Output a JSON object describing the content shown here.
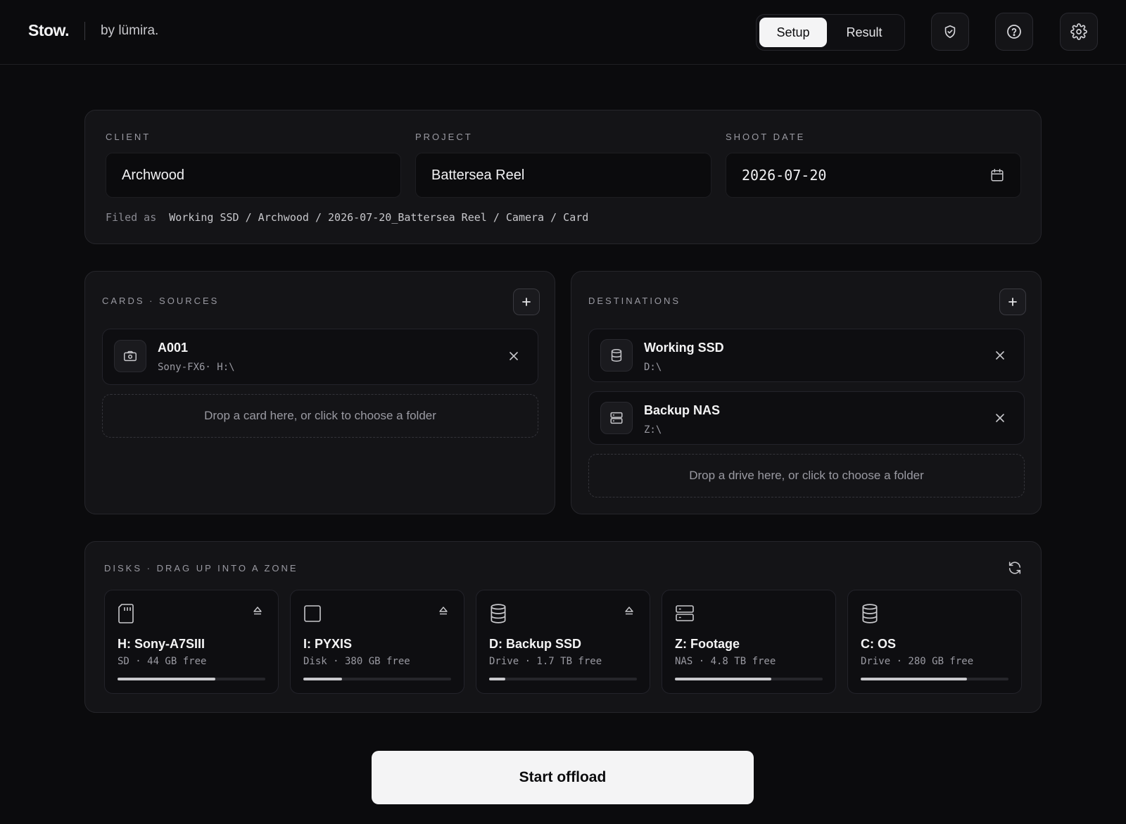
{
  "app": {
    "brand": "Stow.",
    "byline": "by lümira."
  },
  "nav": {
    "tabs": [
      {
        "label": "Setup",
        "active": true
      },
      {
        "label": "Result",
        "active": false
      }
    ],
    "icons": [
      "shield-check-icon",
      "help-icon",
      "gear-icon"
    ]
  },
  "form": {
    "client_label": "CLIENT",
    "client_value": "Archwood",
    "project_label": "PROJECT",
    "project_value": "Battersea Reel",
    "date_label": "SHOOT DATE",
    "date_value": "2026-07-20",
    "filed_as_label": "Filed as",
    "filed_as_path": "Working SSD / Archwood / 2026-07-20_Battersea Reel / Camera / Card"
  },
  "sources": {
    "title": "CARDS · SOURCES",
    "items": [
      {
        "name": "A001",
        "detail": "Sony-FX6· H:\\",
        "icon": "camera-icon"
      }
    ],
    "drop_text": "Drop a card here, or click to choose a folder"
  },
  "destinations": {
    "title": "DESTINATIONS",
    "items": [
      {
        "name": "Working SSD",
        "detail": "D:\\",
        "icon": "database-icon"
      },
      {
        "name": "Backup NAS",
        "detail": "Z:\\",
        "icon": "server-icon"
      }
    ],
    "drop_text": "Drop a drive here, or click to choose a folder"
  },
  "disks": {
    "title": "DISKS · DRAG UP INTO A ZONE",
    "items": [
      {
        "name": "H: Sony-A7SIII",
        "detail": "SD · 44 GB free",
        "icon": "sd-card-icon",
        "ejectable": true,
        "used_fraction": 0.66
      },
      {
        "name": "I: PYXIS",
        "detail": "Disk · 380 GB free",
        "icon": "square-disk-icon",
        "ejectable": true,
        "used_fraction": 0.26
      },
      {
        "name": "D: Backup SSD",
        "detail": "Drive · 1.7 TB free",
        "icon": "database-icon",
        "ejectable": true,
        "used_fraction": 0.11
      },
      {
        "name": "Z: Footage",
        "detail": "NAS · 4.8 TB free",
        "icon": "server-icon",
        "ejectable": false,
        "used_fraction": 0.65
      },
      {
        "name": "C: OS",
        "detail": "Drive · 280 GB free",
        "icon": "database-icon",
        "ejectable": false,
        "used_fraction": 0.72
      }
    ]
  },
  "actions": {
    "start_label": "Start offload"
  }
}
